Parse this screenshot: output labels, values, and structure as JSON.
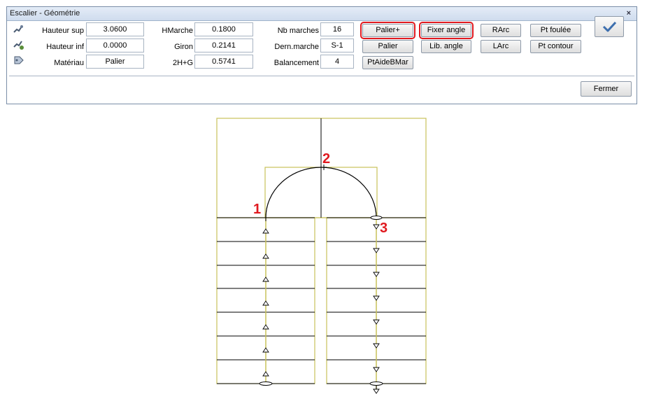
{
  "window": {
    "title": "Escalier - Géométrie",
    "close_glyph": "×"
  },
  "fields": {
    "hauteur_sup": {
      "label": "Hauteur sup",
      "value": "3.0600"
    },
    "hauteur_inf": {
      "label": "Hauteur inf",
      "value": "0.0000"
    },
    "materiau": {
      "label": "Matériau",
      "value": "Palier"
    },
    "hmarche": {
      "label": "HMarche",
      "value": "0.1800"
    },
    "giron": {
      "label": "Giron",
      "value": "0.2141"
    },
    "deux_h_g": {
      "label": "2H+G",
      "value": "0.5741"
    },
    "nb_marches": {
      "label": "Nb marches",
      "value": "16"
    },
    "dern_marche": {
      "label": "Dern.marche",
      "value": "S-1"
    },
    "balancement": {
      "label": "Balancement",
      "value": "4"
    }
  },
  "buttons": {
    "palier_plus": "Palier+",
    "palier": "Palier",
    "pt_aide_bmar": "PtAideBMar",
    "fixer_angle": "Fixer angle",
    "lib_angle": "Lib. angle",
    "rarc": "RArc",
    "larc": "LArc",
    "pt_foulee": "Pt foulée",
    "pt_contour": "Pt contour",
    "fermer": "Fermer"
  },
  "icons": [
    "stair-edit-icon",
    "stair-add-icon",
    "material-tag-icon",
    "checkmark-icon"
  ],
  "highlighted_buttons": [
    "palier_plus",
    "fixer_angle"
  ],
  "highlight_color": "#e0191f",
  "drawing": {
    "markers": [
      "1",
      "2",
      "3"
    ],
    "stair_outline_color": "#c8c25a",
    "line_color": "#000000"
  }
}
